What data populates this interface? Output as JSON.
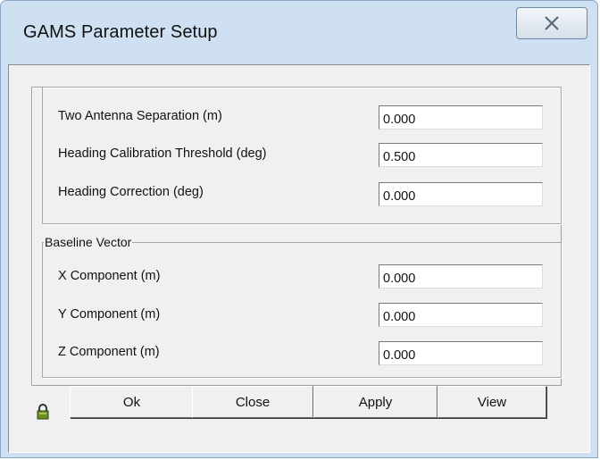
{
  "window": {
    "title": "GAMS Parameter Setup"
  },
  "icons": {
    "close": "close-icon",
    "lock": "lock-icon"
  },
  "params": [
    {
      "label": "Two Antenna Separation (m)",
      "value": "0.000"
    },
    {
      "label": "Heading Calibration Threshold (deg)",
      "value": "0.500"
    },
    {
      "label": "Heading Correction (deg)",
      "value": "0.000"
    }
  ],
  "baseline": {
    "legend": "Baseline Vector",
    "fields": [
      {
        "label": "X Component (m)",
        "value": "0.000"
      },
      {
        "label": "Y Component (m)",
        "value": "0.000"
      },
      {
        "label": "Z Component (m)",
        "value": "0.000"
      }
    ]
  },
  "buttons": {
    "ok": "Ok",
    "close": "Close",
    "apply": "Apply",
    "view": "View"
  },
  "colors": {
    "titlebar": "#cfe0f2",
    "client": "#f0f0f0"
  }
}
